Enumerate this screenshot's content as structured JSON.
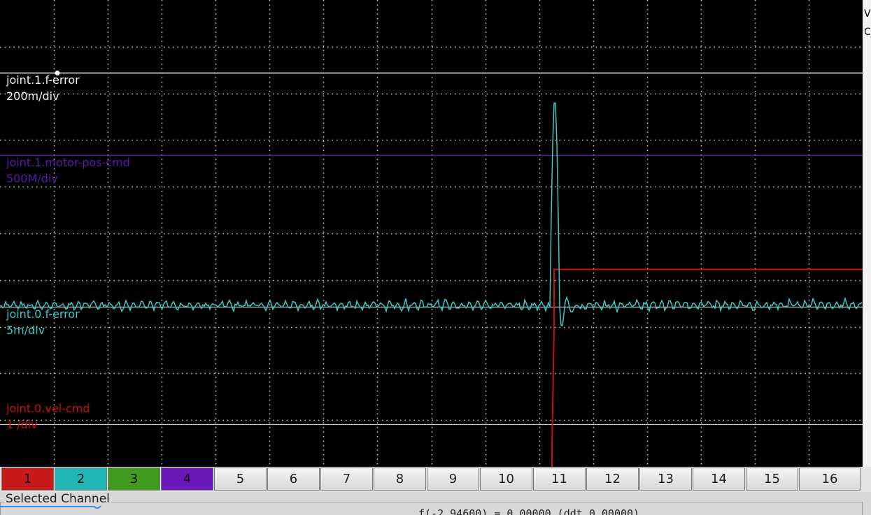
{
  "scope": {
    "colors": {
      "background": "#000000",
      "grid": "#cfcfcf",
      "joint1_ferror": "#f0f0f0",
      "joint1_motor_pos_cmd": "#5a1aa8",
      "joint0_ferror": "#3fc6c6",
      "joint0_vel_cmd": "#c81010"
    },
    "traces": [
      {
        "name": "joint.1.f-error",
        "scale": "200m/div",
        "color": "#f0f0f0"
      },
      {
        "name": "joint.1.motor-pos-cmd",
        "scale": "500M/div",
        "color": "#5a1aa8"
      },
      {
        "name": "joint.0.f-error",
        "scale": "5m/div",
        "color": "#3fc6c6"
      },
      {
        "name": "joint.0.vel-cmd",
        "scale": "1 /div",
        "color": "#c81010"
      }
    ]
  },
  "right_strip": {
    "top_char": "V",
    "second_char": "C"
  },
  "channels": [
    {
      "label": "1",
      "color": "#c81a1a"
    },
    {
      "label": "2",
      "color": "#21b5b5"
    },
    {
      "label": "3",
      "color": "#3f9a1e"
    },
    {
      "label": "4",
      "color": "#6a18b8"
    },
    {
      "label": "5"
    },
    {
      "label": "6"
    },
    {
      "label": "7"
    },
    {
      "label": "8"
    },
    {
      "label": "9"
    },
    {
      "label": "10"
    },
    {
      "label": "11"
    },
    {
      "label": "12"
    },
    {
      "label": "13"
    },
    {
      "label": "14"
    },
    {
      "label": "15"
    },
    {
      "label": "16"
    }
  ],
  "selected_channel": {
    "label": "Selected Channel",
    "readout": "f(-2.94600) = 0.00000 (ddt 0.00000)"
  }
}
